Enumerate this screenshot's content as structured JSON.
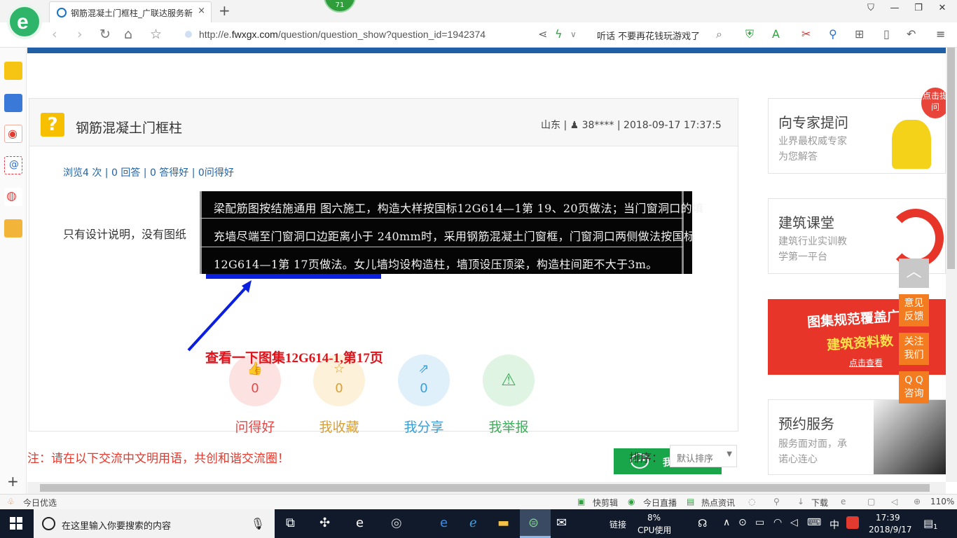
{
  "browser": {
    "tab_title": "钢筋混凝土门框柱_广联达服务新",
    "tab_close": "×",
    "new_tab": "+",
    "badge_count": "71",
    "url_prefix": "http://e.",
    "url_domain": "fwxgx.com",
    "url_path": "/question/question_show?question_id=1942374",
    "hot_search": "听话 不要再花钱玩游戏了",
    "zoom": "110%"
  },
  "question": {
    "title": "钢筋混凝土门框柱",
    "meta": "山东 | ♟ 38**** | 2018-09-17 17:37:5",
    "stats": "浏览4 次 | 0 回答 | 0 答得好 | 0问得好",
    "body": "只有设计说明，没有图纸",
    "image_lines": [
      "梁配筋图按结施通用 图六施工，构造大样按国标12G614—1第 19、20页做法；当门窗洞口的填",
      "充墙尽端至门窗洞口边距离小于  240mm时，采用钢筋混凝土门窗框，门窗洞口两侧做法按国标",
      "12G614—1第 17页做法。女儿墙均设构造柱，墙顶设压顶梁，构造柱间距不大于3m。"
    ],
    "annotation": "查看一下图集12G614-1,第17页",
    "actions": [
      {
        "label": "问得好",
        "count": "0",
        "color": "#e24a4a",
        "bg": "#fde2e2",
        "icon": "thumbs-up-icon"
      },
      {
        "label": "我收藏",
        "count": "0",
        "color": "#d9a036",
        "bg": "#fdf1d9",
        "icon": "star-icon"
      },
      {
        "label": "我分享",
        "count": "0",
        "color": "#3a9fd8",
        "bg": "#dff0fb",
        "icon": "share-icon"
      },
      {
        "label": "我举报",
        "count": "",
        "color": "#3fae5a",
        "bg": "#e0f4e4",
        "icon": "warning-icon"
      }
    ],
    "reply_button": "我来回答",
    "notice": "注：请在以下交流中文明用语，共创和谐交流圈！",
    "sort_label": "排序：",
    "sort_value": "默认排序"
  },
  "ads": {
    "expert": {
      "title": "向专家提问",
      "sub1": "业界最权威专家",
      "sub2": "为您解答",
      "bubble": "点击提问"
    },
    "course": {
      "title": "建筑课堂",
      "sub1": "建筑行业实训教",
      "sub2": "学第一平台"
    },
    "banner": {
      "line1": "图集规范覆盖广",
      "line2": "建筑资料数",
      "cta": "点击查看"
    },
    "service": {
      "title": "预约服务",
      "sub1": "服务面对面，承",
      "sub2": "诺心连心"
    }
  },
  "float_buttons": [
    {
      "label": "意见\n反馈"
    },
    {
      "label": "关注\n我们"
    },
    {
      "label": "Q Q\n咨询"
    }
  ],
  "statusbar": {
    "left": "今日优选",
    "items": [
      "快剪辑",
      "今日直播",
      "热点资讯",
      "下载"
    ],
    "zoom": "110%"
  },
  "taskbar": {
    "search_placeholder": "在这里输入你要搜索的内容",
    "link_label": "链接",
    "cpu_percent": "8%",
    "cpu_label": "CPU使用",
    "ime": "中",
    "time": "17:39",
    "date": "2018/9/17",
    "notif_count": "1"
  }
}
